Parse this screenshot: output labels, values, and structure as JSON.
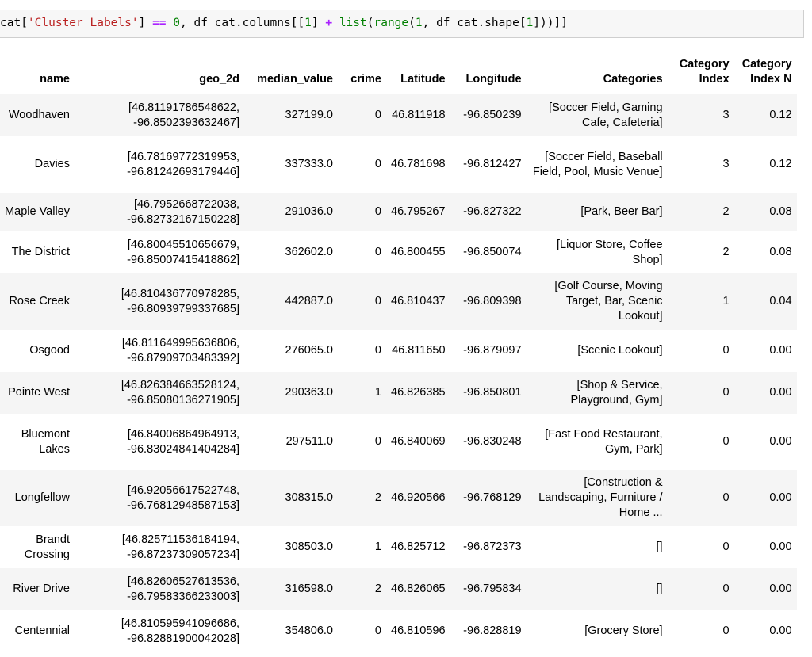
{
  "code_cell": {
    "parts": [
      "cat[",
      "'Cluster Labels'",
      "] ",
      "==",
      " ",
      "0",
      ", df_cat.columns[[",
      "1",
      "] ",
      "+",
      " ",
      "list",
      "(",
      "range",
      "(",
      "1",
      ", df_cat.shape[",
      "1",
      "]))]]"
    ]
  },
  "table": {
    "headers": [
      "name",
      "geo_2d",
      "median_value",
      "crime",
      "Latitude",
      "Longitude",
      "Categories",
      "Category Index",
      "Category Index N"
    ],
    "rows": [
      {
        "name": "Woodhaven",
        "geo_2d": "[46.81191786548622, -96.8502393632467]",
        "median_value": "327199.0",
        "crime": "0",
        "lat": "46.811918",
        "lon": "-96.850239",
        "categories": "[Soccer Field, Gaming Cafe, Cafeteria]",
        "cat_index": "3",
        "cat_index_n": "0.12"
      },
      {
        "name": "Davies",
        "geo_2d": "[46.78169772319953, -96.81242693179446]",
        "median_value": "337333.0",
        "crime": "0",
        "lat": "46.781698",
        "lon": "-96.812427",
        "categories": "[Soccer Field, Baseball Field, Pool, Music Venue]",
        "cat_index": "3",
        "cat_index_n": "0.12"
      },
      {
        "name": "Maple Valley",
        "geo_2d": "[46.7952668722038, -96.82732167150228]",
        "median_value": "291036.0",
        "crime": "0",
        "lat": "46.795267",
        "lon": "-96.827322",
        "categories": "[Park, Beer Bar]",
        "cat_index": "2",
        "cat_index_n": "0.08"
      },
      {
        "name": "The District",
        "geo_2d": "[46.80045510656679, -96.85007415418862]",
        "median_value": "362602.0",
        "crime": "0",
        "lat": "46.800455",
        "lon": "-96.850074",
        "categories": "[Liquor Store, Coffee Shop]",
        "cat_index": "2",
        "cat_index_n": "0.08"
      },
      {
        "name": "Rose Creek",
        "geo_2d": "[46.810436770978285, -96.80939799337685]",
        "median_value": "442887.0",
        "crime": "0",
        "lat": "46.810437",
        "lon": "-96.809398",
        "categories": "[Golf Course, Moving Target, Bar, Scenic Lookout]",
        "cat_index": "1",
        "cat_index_n": "0.04"
      },
      {
        "name": "Osgood",
        "geo_2d": "[46.811649995636806, -96.87909703483392]",
        "median_value": "276065.0",
        "crime": "0",
        "lat": "46.811650",
        "lon": "-96.879097",
        "categories": "[Scenic Lookout]",
        "cat_index": "0",
        "cat_index_n": "0.00"
      },
      {
        "name": "Pointe West",
        "geo_2d": "[46.826384663528124, -96.85080136271905]",
        "median_value": "290363.0",
        "crime": "1",
        "lat": "46.826385",
        "lon": "-96.850801",
        "categories": "[Shop & Service, Playground, Gym]",
        "cat_index": "0",
        "cat_index_n": "0.00"
      },
      {
        "name": "Bluemont Lakes",
        "geo_2d": "[46.84006864964913, -96.83024841404284]",
        "median_value": "297511.0",
        "crime": "0",
        "lat": "46.840069",
        "lon": "-96.830248",
        "categories": "[Fast Food Restaurant, Gym, Park]",
        "cat_index": "0",
        "cat_index_n": "0.00"
      },
      {
        "name": "Longfellow",
        "geo_2d": "[46.92056617522748, -96.76812948587153]",
        "median_value": "308315.0",
        "crime": "2",
        "lat": "46.920566",
        "lon": "-96.768129",
        "categories": "[Construction & Landscaping, Furniture / Home ...",
        "cat_index": "0",
        "cat_index_n": "0.00"
      },
      {
        "name": "Brandt Crossing",
        "geo_2d": "[46.825711536184194, -96.87237309057234]",
        "median_value": "308503.0",
        "crime": "1",
        "lat": "46.825712",
        "lon": "-96.872373",
        "categories": "[]",
        "cat_index": "0",
        "cat_index_n": "0.00"
      },
      {
        "name": "River Drive",
        "geo_2d": "[46.82606527613536, -96.79583366233003]",
        "median_value": "316598.0",
        "crime": "2",
        "lat": "46.826065",
        "lon": "-96.795834",
        "categories": "[]",
        "cat_index": "0",
        "cat_index_n": "0.00"
      },
      {
        "name": "Centennial",
        "geo_2d": "[46.810595941096686, -96.82881900042028]",
        "median_value": "354806.0",
        "crime": "0",
        "lat": "46.810596",
        "lon": "-96.828819",
        "categories": "[Grocery Store]",
        "cat_index": "0",
        "cat_index_n": "0.00"
      }
    ]
  }
}
